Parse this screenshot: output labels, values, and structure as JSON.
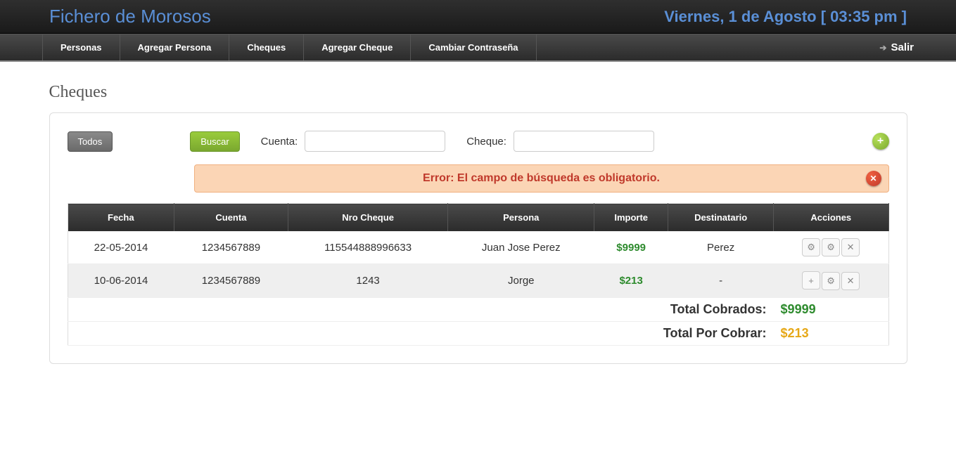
{
  "header": {
    "brand": "Fichero de Morosos",
    "datetime": "Viernes, 1 de Agosto [ 03:35 pm ]"
  },
  "nav": {
    "items": [
      "Personas",
      "Agregar Persona",
      "Cheques",
      "Agregar Cheque",
      "Cambiar Contraseña"
    ],
    "logout": "Salir"
  },
  "page": {
    "title": "Cheques"
  },
  "toolbar": {
    "todos": "Todos",
    "buscar": "Buscar",
    "cuenta_label": "Cuenta:",
    "cheque_label": "Cheque:",
    "cuenta_value": "",
    "cheque_value": ""
  },
  "alert": {
    "text": "Error: El campo de búsqueda es obligatorio."
  },
  "table": {
    "headers": [
      "Fecha",
      "Cuenta",
      "Nro Cheque",
      "Persona",
      "Importe",
      "Destinatario",
      "Acciones"
    ],
    "rows": [
      {
        "fecha": "22-05-2014",
        "cuenta": "1234567889",
        "nro": "115544888996633",
        "persona": "Juan Jose Perez",
        "importe": "$9999",
        "dest": "Perez",
        "first_icon": "gear"
      },
      {
        "fecha": "10-06-2014",
        "cuenta": "1234567889",
        "nro": "1243",
        "persona": "Jorge",
        "importe": "$213",
        "dest": "-",
        "first_icon": "plus"
      }
    ]
  },
  "totals": {
    "cobrados_label": "Total Cobrados:",
    "cobrados_value": "$9999",
    "porcobrar_label": "Total Por Cobrar:",
    "porcobrar_value": "$213"
  }
}
